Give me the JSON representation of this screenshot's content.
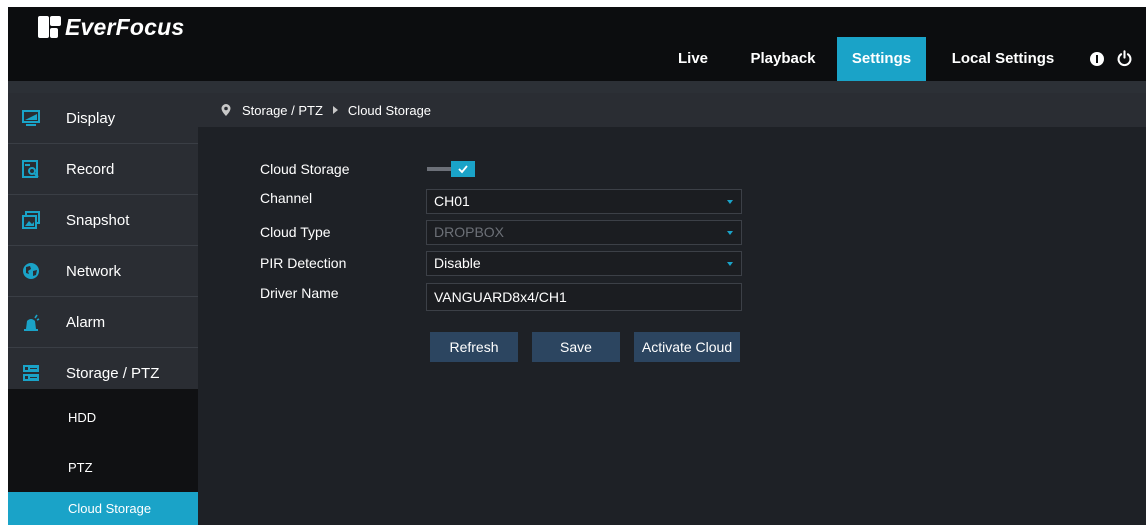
{
  "brand": {
    "logo_text": "EverFocus"
  },
  "nav": {
    "live": "Live",
    "playback": "Playback",
    "settings": "Settings",
    "local_settings": "Local Settings"
  },
  "sidebar": {
    "items": [
      {
        "label": "Display",
        "icon": "monitor-icon"
      },
      {
        "label": "Record",
        "icon": "record-search-icon"
      },
      {
        "label": "Snapshot",
        "icon": "snapshot-icon"
      },
      {
        "label": "Network",
        "icon": "network-globe-icon"
      },
      {
        "label": "Alarm",
        "icon": "alarm-siren-icon"
      },
      {
        "label": "Storage / PTZ",
        "icon": "storage-icon"
      }
    ],
    "sub_items": [
      {
        "label": "HDD"
      },
      {
        "label": "PTZ"
      },
      {
        "label": "Cloud Storage"
      }
    ]
  },
  "breadcrumb": {
    "section": "Storage / PTZ",
    "page": "Cloud Storage"
  },
  "form": {
    "cloud_storage_label": "Cloud Storage",
    "cloud_storage_enabled": true,
    "channel_label": "Channel",
    "channel_value": "CH01",
    "cloud_type_label": "Cloud Type",
    "cloud_type_value": "DROPBOX",
    "pir_label": "PIR Detection",
    "pir_value": "Disable",
    "driver_name_label": "Driver Name",
    "driver_name_value": "VANGUARD8x4/CH1"
  },
  "buttons": {
    "refresh": "Refresh",
    "save": "Save",
    "activate": "Activate Cloud"
  },
  "colors": {
    "accent": "#1aa3c8",
    "topbar": "#0c0d0f",
    "panel": "#1e2126",
    "sidebar": "#2a2d33",
    "button": "#2c4560"
  }
}
